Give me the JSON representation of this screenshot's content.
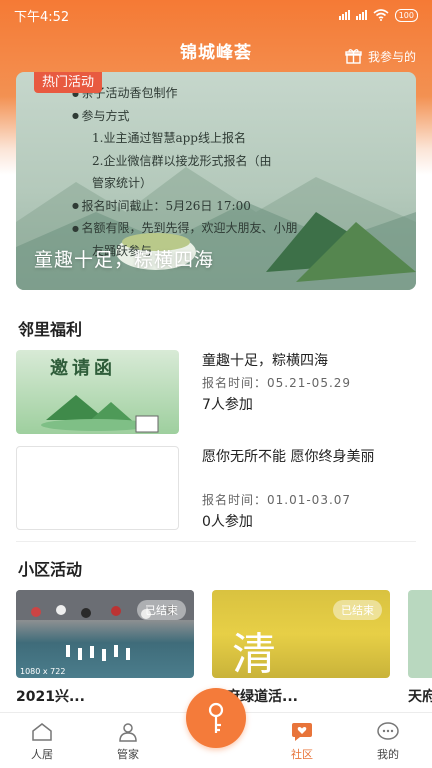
{
  "status": {
    "time": "下午4:52",
    "battery": "100"
  },
  "header": {
    "title": "锦城峰荟",
    "my_participation": "我参与的"
  },
  "banner": {
    "tag": "热门活动",
    "title": "童趣十足，粽横四海",
    "notes": [
      "亲子活动香包制作",
      "参与方式",
      "1.业主通过智慧app线上报名",
      "2.企业微信群以接龙形式报名（由",
      "管家统计）",
      "报名时间截止：5月26日 17:00",
      "名额有限，先到先得，欢迎大朋友、小朋",
      "友踊跃参与"
    ]
  },
  "welfare": {
    "section_title": "邻里福利",
    "items": [
      {
        "title": "童趣十足，粽横四海",
        "time": "报名时间：05.21-05.29",
        "count": "7人参加",
        "thumb_text": "邀请函"
      },
      {
        "title": "愿你无所不能 愿你终身美丽",
        "time": "报名时间：01.01-03.07",
        "count": "0人参加"
      }
    ]
  },
  "activities": {
    "section_title": "小区活动",
    "items": [
      {
        "title": "2021兴...",
        "tag": "已结束",
        "thumb_caption": "1080 x 722"
      },
      {
        "title": "天府绿道活...",
        "tag": "已结束",
        "thumb_text": "清"
      },
      {
        "title": "天府"
      }
    ]
  },
  "tabs": [
    {
      "label": "人居",
      "icon": "house-icon"
    },
    {
      "label": "管家",
      "icon": "butler-icon"
    },
    {
      "label": "社区",
      "icon": "heart-chat-icon",
      "active": true
    },
    {
      "label": "我的",
      "icon": "chat-bubble-icon"
    }
  ],
  "colors": {
    "accent": "#f47b3a",
    "hot_tag": "#e85a40",
    "active_tab": "#e8743a"
  }
}
